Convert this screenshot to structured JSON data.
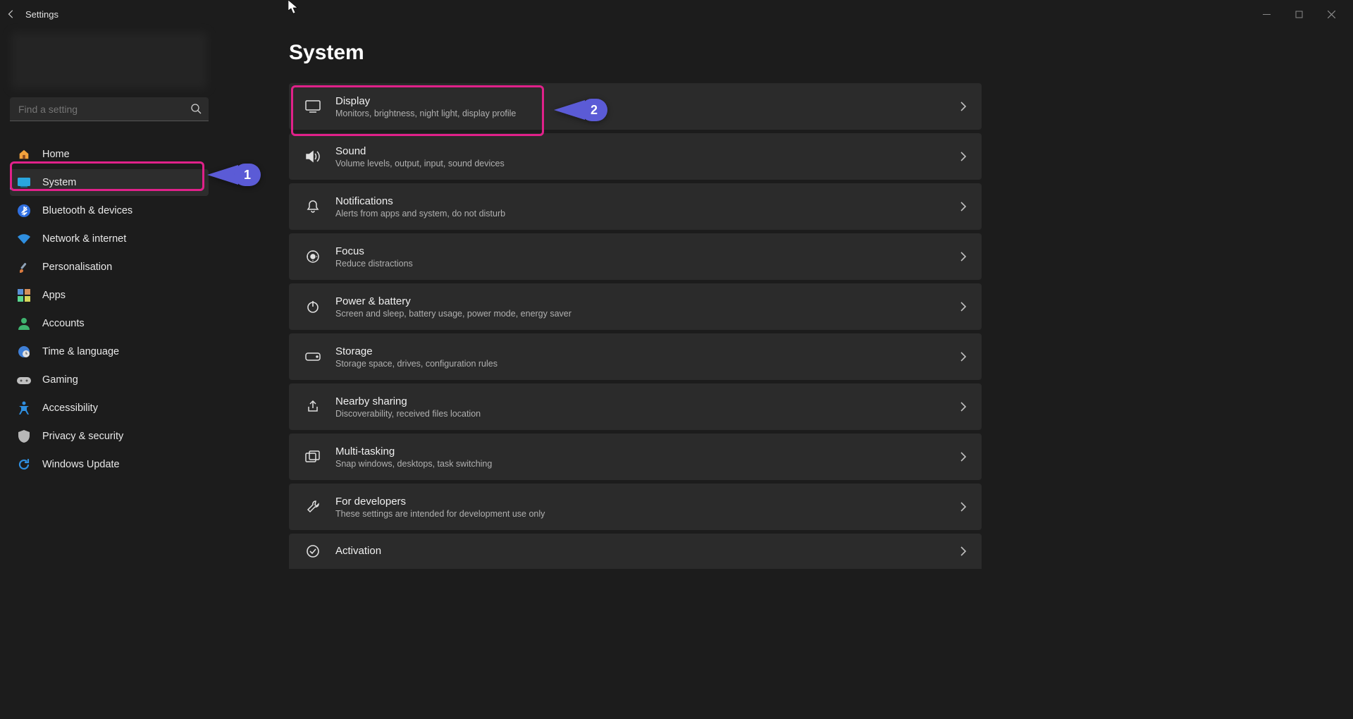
{
  "window": {
    "title": "Settings"
  },
  "search": {
    "placeholder": "Find a setting"
  },
  "nav": {
    "items": [
      {
        "label": "Home"
      },
      {
        "label": "System"
      },
      {
        "label": "Bluetooth & devices"
      },
      {
        "label": "Network & internet"
      },
      {
        "label": "Personalisation"
      },
      {
        "label": "Apps"
      },
      {
        "label": "Accounts"
      },
      {
        "label": "Time & language"
      },
      {
        "label": "Gaming"
      },
      {
        "label": "Accessibility"
      },
      {
        "label": "Privacy & security"
      },
      {
        "label": "Windows Update"
      }
    ]
  },
  "page": {
    "title": "System"
  },
  "cards": [
    {
      "title": "Display",
      "desc": "Monitors, brightness, night light, display profile"
    },
    {
      "title": "Sound",
      "desc": "Volume levels, output, input, sound devices"
    },
    {
      "title": "Notifications",
      "desc": "Alerts from apps and system, do not disturb"
    },
    {
      "title": "Focus",
      "desc": "Reduce distractions"
    },
    {
      "title": "Power & battery",
      "desc": "Screen and sleep, battery usage, power mode, energy saver"
    },
    {
      "title": "Storage",
      "desc": "Storage space, drives, configuration rules"
    },
    {
      "title": "Nearby sharing",
      "desc": "Discoverability, received files location"
    },
    {
      "title": "Multi-tasking",
      "desc": "Snap windows, desktops, task switching"
    },
    {
      "title": "For developers",
      "desc": "These settings are intended for development use only"
    },
    {
      "title": "Activation",
      "desc": ""
    }
  ],
  "annotations": {
    "callout1": "1",
    "callout2": "2"
  }
}
